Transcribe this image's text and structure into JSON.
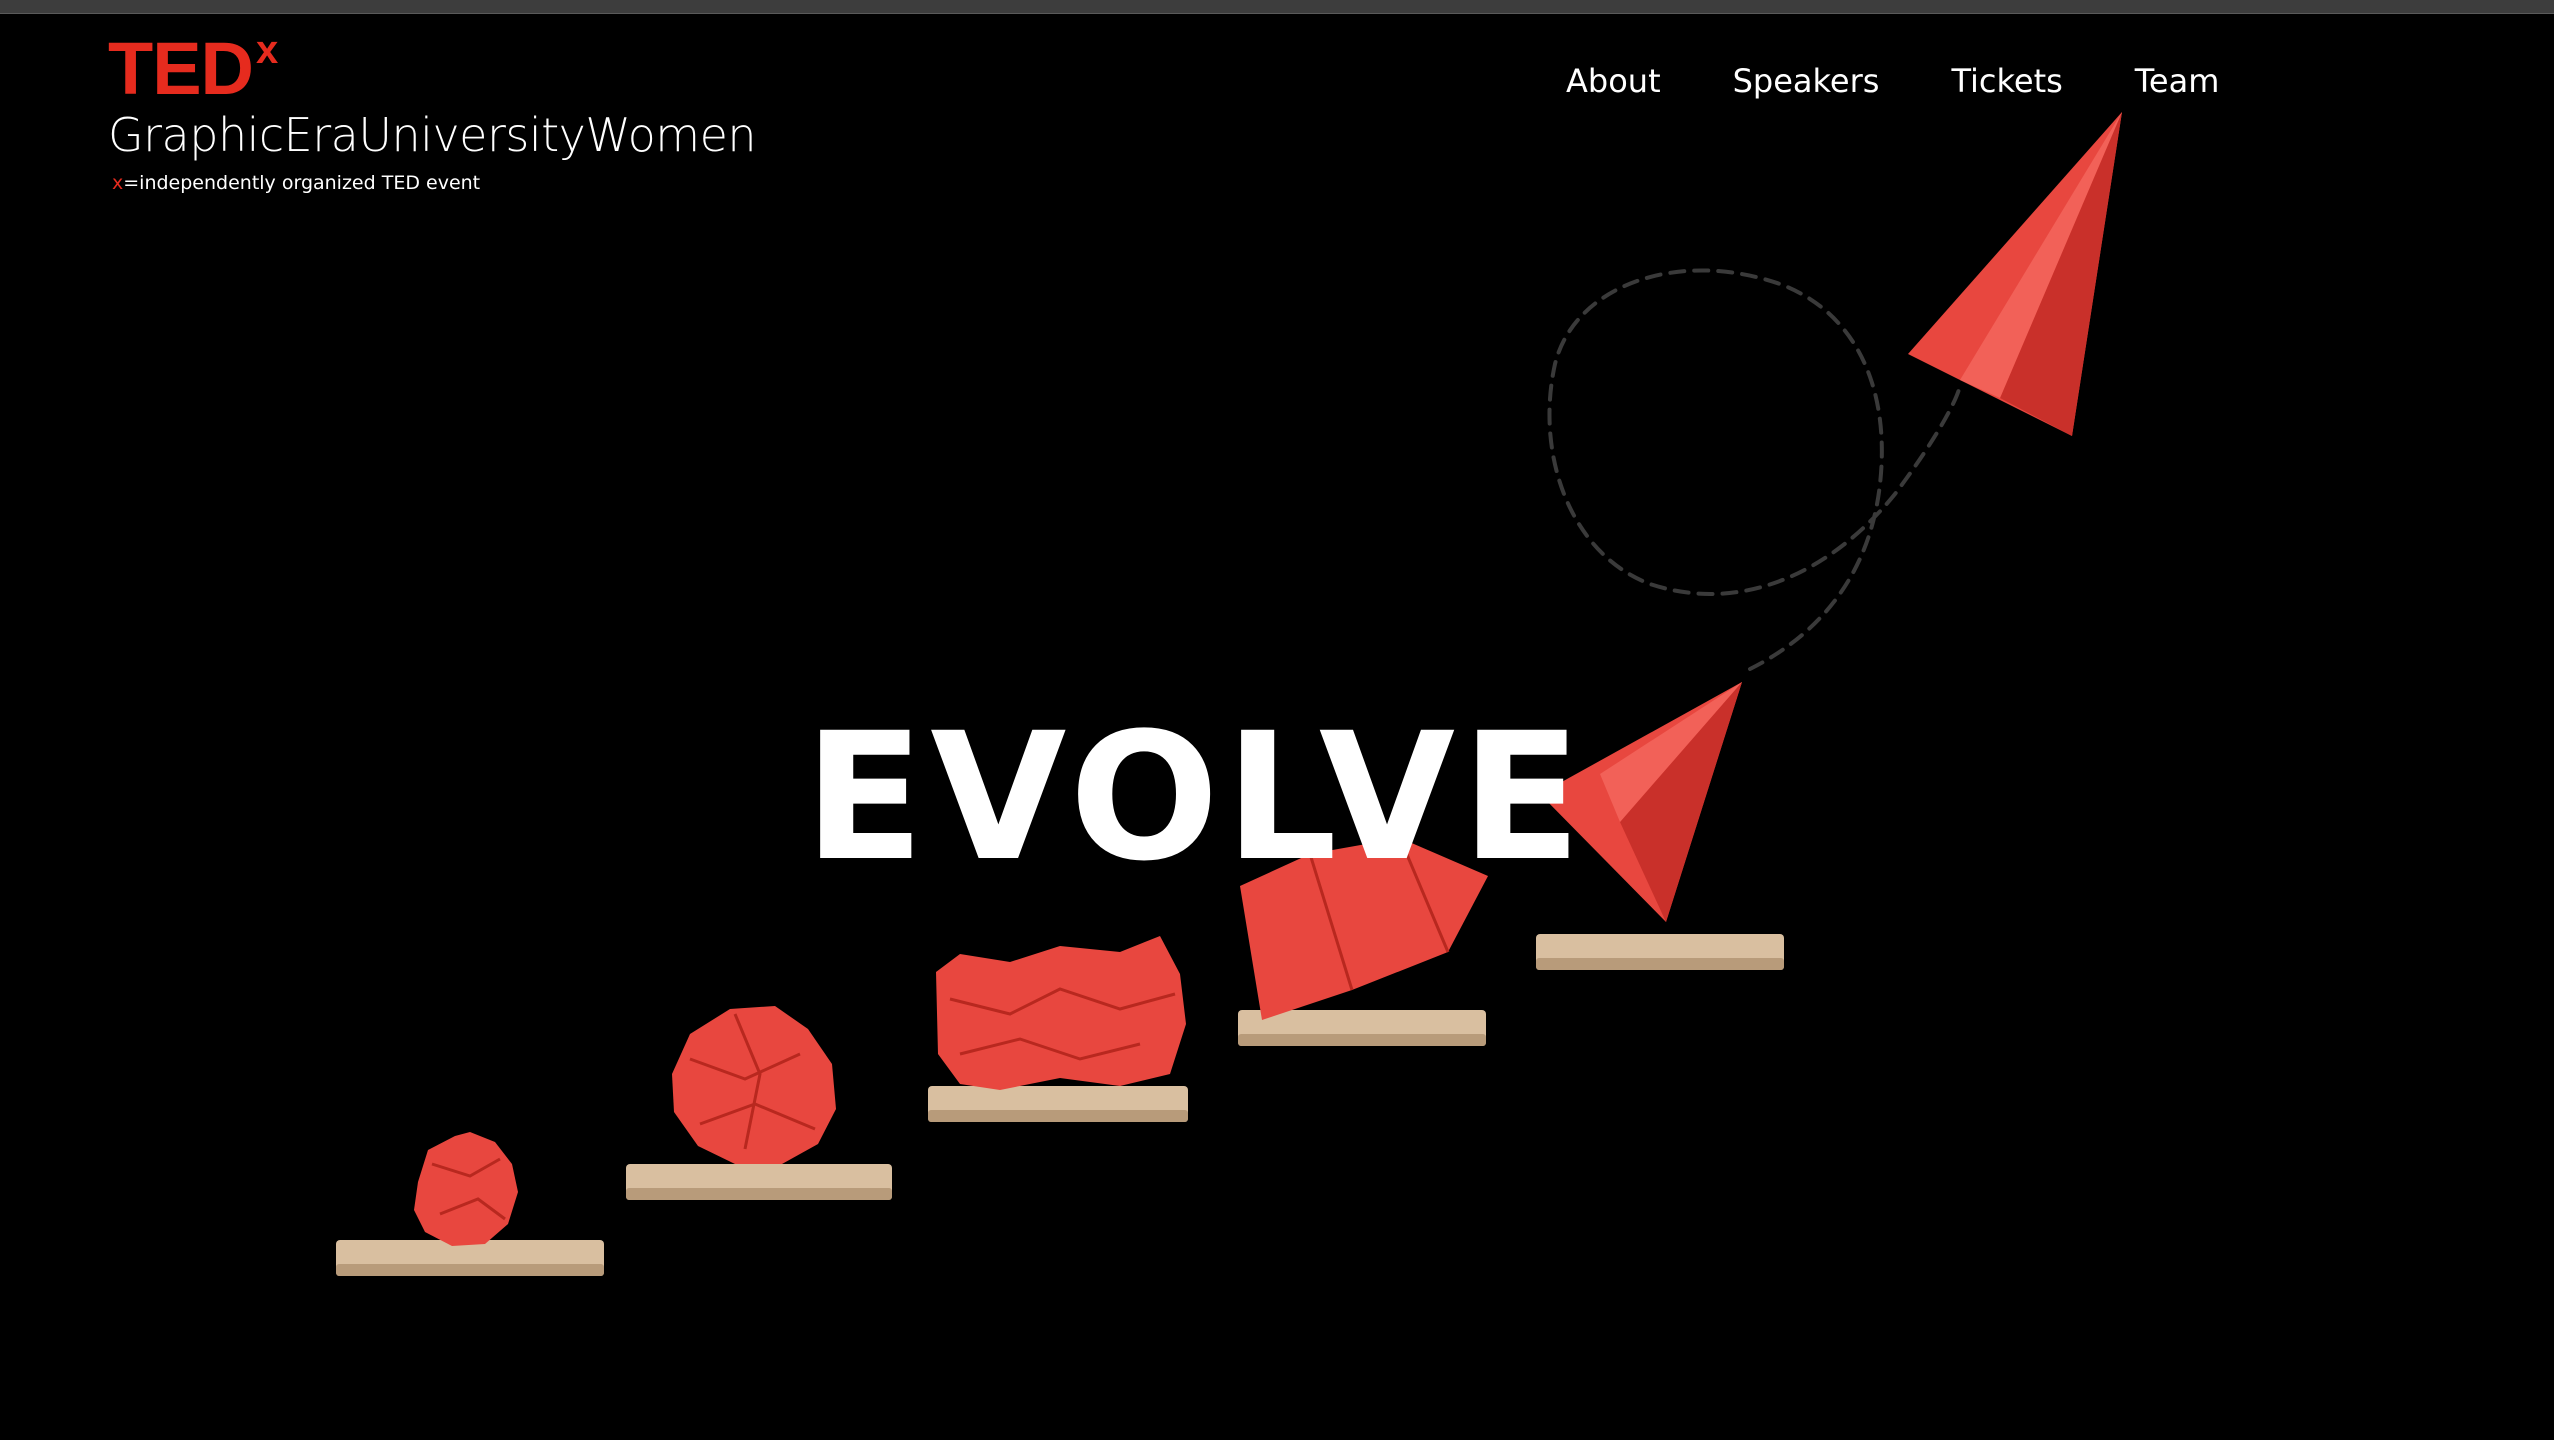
{
  "header": {
    "logo_word": "TED",
    "logo_superscript": "x",
    "event_name": "GraphicEraUniversityWomen",
    "tagline_x": "x",
    "tagline_rest": "=independently organized TED event"
  },
  "nav": {
    "items": [
      {
        "label": "About"
      },
      {
        "label": "Speakers"
      },
      {
        "label": "Tickets"
      },
      {
        "label": "Team"
      }
    ]
  },
  "hero": {
    "theme_title": "EVOLVE"
  },
  "colors": {
    "brand_red": "#e62b1e",
    "background": "#000000",
    "paper_red": "#e8473f",
    "wood": "#d9bfa0"
  }
}
